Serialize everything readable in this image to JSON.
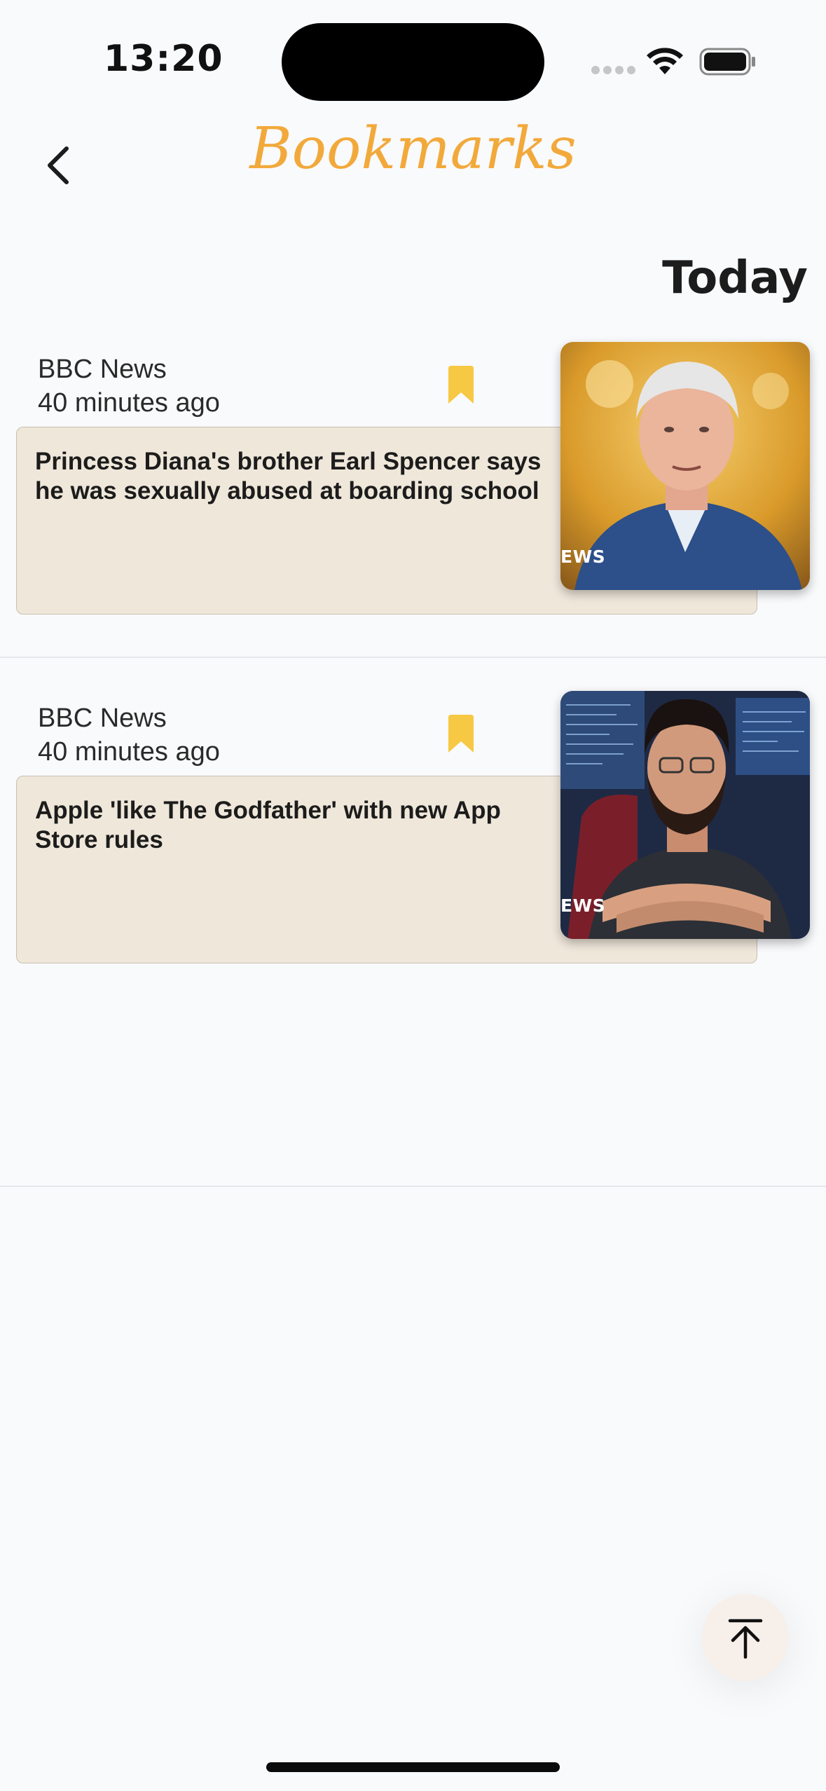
{
  "status_bar": {
    "time": "13:20"
  },
  "header": {
    "title": "Bookmarks",
    "back_icon": "chevron-left-icon"
  },
  "section": {
    "heading": "Today"
  },
  "articles": [
    {
      "source": "BBC News",
      "time": "40 minutes ago",
      "headline": "Princess Diana's brother Earl Spencer says he was sexually abused at boarding school",
      "thumb_badge": "EWS",
      "bookmark_icon": "bookmark-icon"
    },
    {
      "source": "BBC News",
      "time": "40 minutes ago",
      "headline": "Apple 'like The Godfather' with new App Store rules",
      "thumb_badge": "EWS",
      "bookmark_icon": "bookmark-icon"
    }
  ],
  "fab": {
    "icon": "scroll-to-top-icon"
  },
  "colors": {
    "accent": "#f2a93b",
    "bookmark": "#f7c844",
    "card_bg": "#efe7da",
    "page_bg": "#f9fafc"
  }
}
